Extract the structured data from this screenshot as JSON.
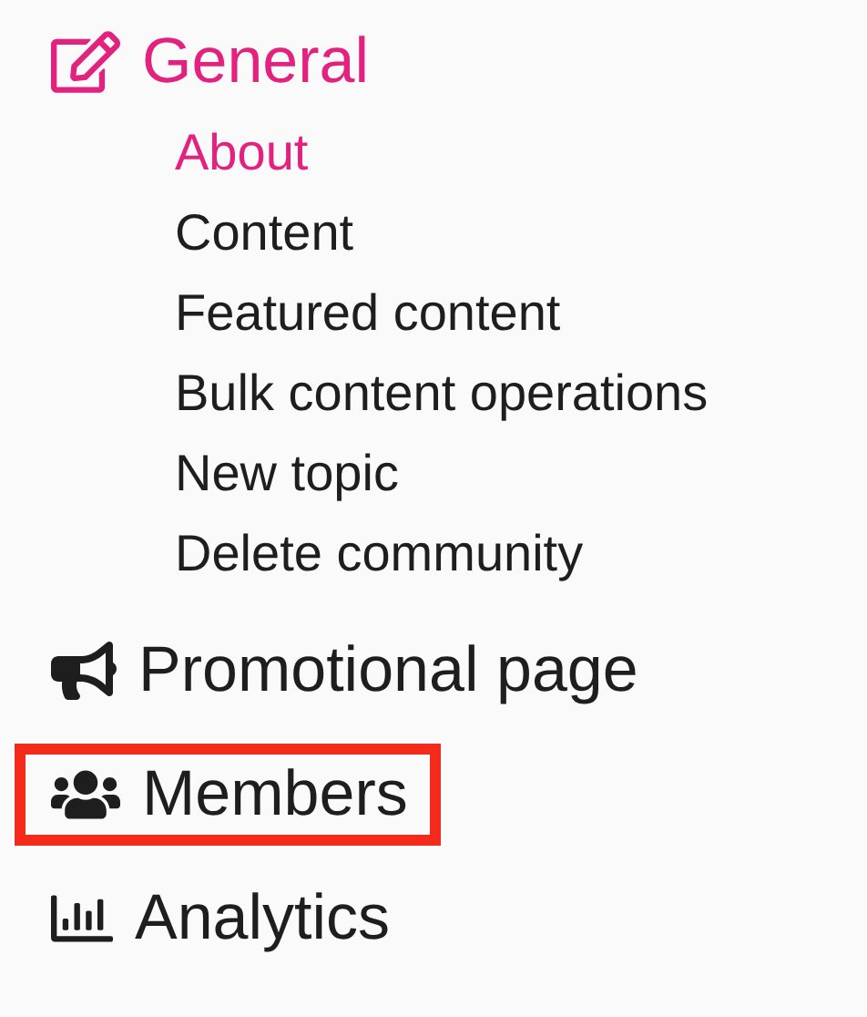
{
  "sections": [
    {
      "label": "General",
      "selected": true,
      "highlighted": false,
      "children": [
        {
          "label": "About",
          "selected": true
        },
        {
          "label": "Content",
          "selected": false
        },
        {
          "label": "Featured content",
          "selected": false
        },
        {
          "label": "Bulk content operations",
          "selected": false
        },
        {
          "label": "New topic",
          "selected": false
        },
        {
          "label": "Delete community",
          "selected": false
        }
      ]
    },
    {
      "label": "Promotional page",
      "selected": false,
      "highlighted": false
    },
    {
      "label": "Members",
      "selected": false,
      "highlighted": true
    },
    {
      "label": "Analytics",
      "selected": false,
      "highlighted": false
    }
  ]
}
